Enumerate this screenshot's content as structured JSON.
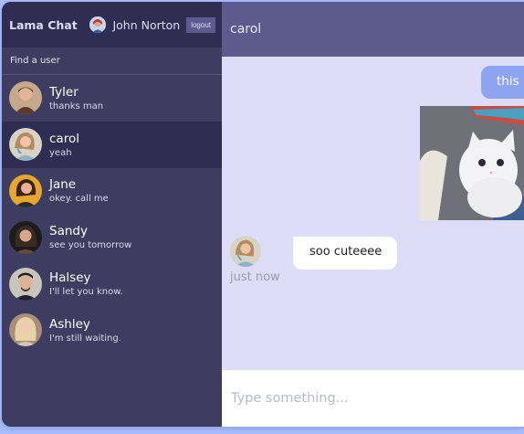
{
  "app": {
    "title": "Lama Chat"
  },
  "current_user": {
    "name": "John Norton",
    "logout_label": "logout"
  },
  "search": {
    "placeholder": "Find a user"
  },
  "chats": [
    {
      "name": "Tyler",
      "last_message": "thanks man"
    },
    {
      "name": "carol",
      "last_message": "yeah"
    },
    {
      "name": "Jane",
      "last_message": "okey. call me"
    },
    {
      "name": "Sandy",
      "last_message": "see you tomorrow"
    },
    {
      "name": "Halsey",
      "last_message": "I'll let you know."
    },
    {
      "name": "Ashley",
      "last_message": "I'm still waiting."
    }
  ],
  "active_chat": {
    "name": "carol",
    "messages": [
      {
        "owner": true,
        "text": "this i"
      },
      {
        "owner": false,
        "text": "soo cuteeee",
        "time": "just now"
      }
    ]
  },
  "composer": {
    "placeholder": "Type something..."
  },
  "colors": {
    "sidebar": "#3e3c61",
    "navbar": "#2f2d52",
    "header": "#5d5b8d",
    "chat_bg": "#ddddf7",
    "owner_bubble": "#8da4f1"
  }
}
